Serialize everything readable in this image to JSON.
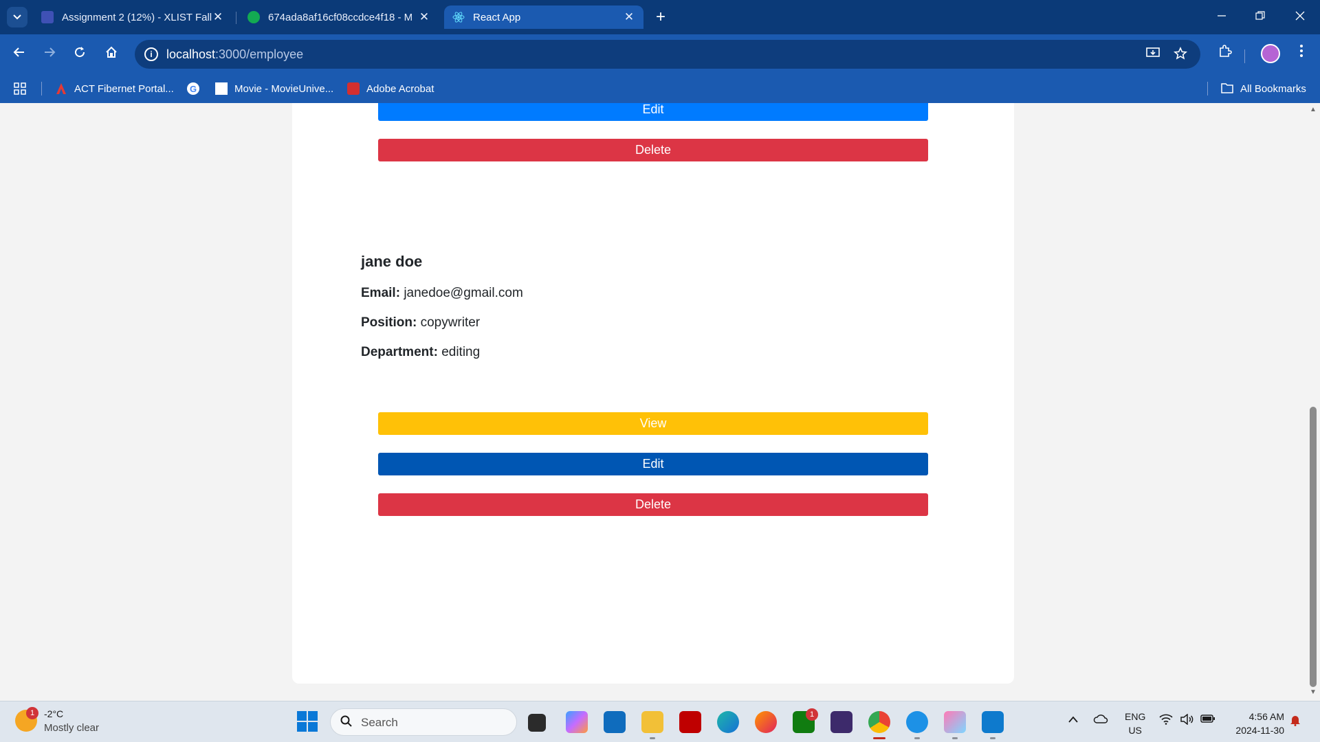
{
  "browser": {
    "tabs": [
      {
        "title": "Assignment 2 (12%) - XLIST Fall",
        "icon": "shield-icon",
        "color": "#3f51b5",
        "active": false
      },
      {
        "title": "674ada8af16cf08ccdce4f18 - M",
        "icon": "leaf-icon",
        "color": "#13aa52",
        "active": false
      },
      {
        "title": "React App",
        "icon": "react-icon",
        "color": "#61dafb",
        "active": true
      }
    ],
    "close_glyph": "✕",
    "new_tab_glyph": "+",
    "url_host": "localhost",
    "url_path": ":3000/employee",
    "bookmarks": [
      {
        "label": "ACT Fibernet Portal...",
        "icon": "act-logo-icon",
        "color": "#e53935"
      },
      {
        "label": "",
        "icon": "google-icon",
        "color": "#ffffff"
      },
      {
        "label": "Movie - MovieUnive...",
        "icon": "page-icon",
        "color": "#ffffff"
      },
      {
        "label": "Adobe Acrobat",
        "icon": "acrobat-icon",
        "color": "#d32f2f"
      }
    ],
    "all_bookmarks": "All Bookmarks"
  },
  "page": {
    "previous_employee_actions": {
      "edit": "Edit",
      "delete": "Delete"
    },
    "employee": {
      "name": "jane doe",
      "email_label": "Email:",
      "email": "janedoe@gmail.com",
      "position_label": "Position:",
      "position": "copywriter",
      "department_label": "Department:",
      "department": "editing",
      "view_label": "View",
      "edit_label": "Edit",
      "delete_label": "Delete"
    },
    "colors": {
      "view": "#ffc107",
      "edit": "#007bff",
      "edit_hover": "#0056b3",
      "delete": "#dc3545"
    }
  },
  "taskbar": {
    "weather_badge": "1",
    "temperature": "-2°C",
    "weather": "Mostly clear",
    "search_placeholder": "Search",
    "xbox_badge": "1",
    "language": "ENG",
    "region": "US",
    "time": "4:56 AM",
    "date": "2024-11-30"
  }
}
